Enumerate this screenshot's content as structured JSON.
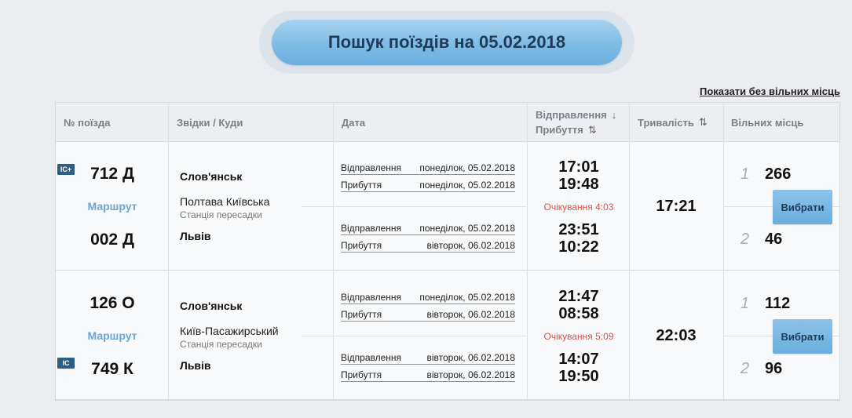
{
  "header": {
    "search_title": "Пошук поїздів на 05.02.2018",
    "show_without_seats": "Показати без вільних місць"
  },
  "table": {
    "columns": {
      "train_no": "№ поїзда",
      "from_to": "Звідки / Куди",
      "date": "Дата",
      "departure": "Відправлення",
      "arrival": "Прибуття",
      "duration": "Тривалість",
      "free_seats": "Вільних місць"
    },
    "labels": {
      "departure": "Відправлення",
      "arrival": "Прибуття",
      "route": "Маршрут",
      "transfer_station": "Станція пересадки",
      "choose": "Вибрати"
    },
    "rows": [
      {
        "train1": "712 Д",
        "train1_badge": "IC+",
        "train2": "002 Д",
        "train2_badge": "",
        "from": "Слов'янськ",
        "transfer": "Полтава Київська",
        "to": "Львів",
        "leg1_dep_date": "понеділок, 05.02.2018",
        "leg1_arr_date": "понеділок, 05.02.2018",
        "leg2_dep_date": "понеділок, 05.02.2018",
        "leg2_arr_date": "вівторок, 06.02.2018",
        "leg1_dep_time": "17:01",
        "leg1_arr_time": "19:48",
        "wait": "Очікування 4:03",
        "leg2_dep_time": "23:51",
        "leg2_arr_time": "10:22",
        "duration": "17:21",
        "class1": "1",
        "seats1": "266",
        "class2": "2",
        "seats2": "46"
      },
      {
        "train1": "126 О",
        "train1_badge": "",
        "train2": "749 К",
        "train2_badge": "IC",
        "from": "Слов'янськ",
        "transfer": "Київ-Пасажирський",
        "to": "Львів",
        "leg1_dep_date": "понеділок, 05.02.2018",
        "leg1_arr_date": "вівторок, 06.02.2018",
        "leg2_dep_date": "вівторок, 06.02.2018",
        "leg2_arr_date": "вівторок, 06.02.2018",
        "leg1_dep_time": "21:47",
        "leg1_arr_time": "08:58",
        "wait": "Очікування 5:09",
        "leg2_dep_time": "14:07",
        "leg2_arr_time": "19:50",
        "duration": "22:03",
        "class1": "1",
        "seats1": "112",
        "class2": "2",
        "seats2": "96"
      }
    ]
  }
}
